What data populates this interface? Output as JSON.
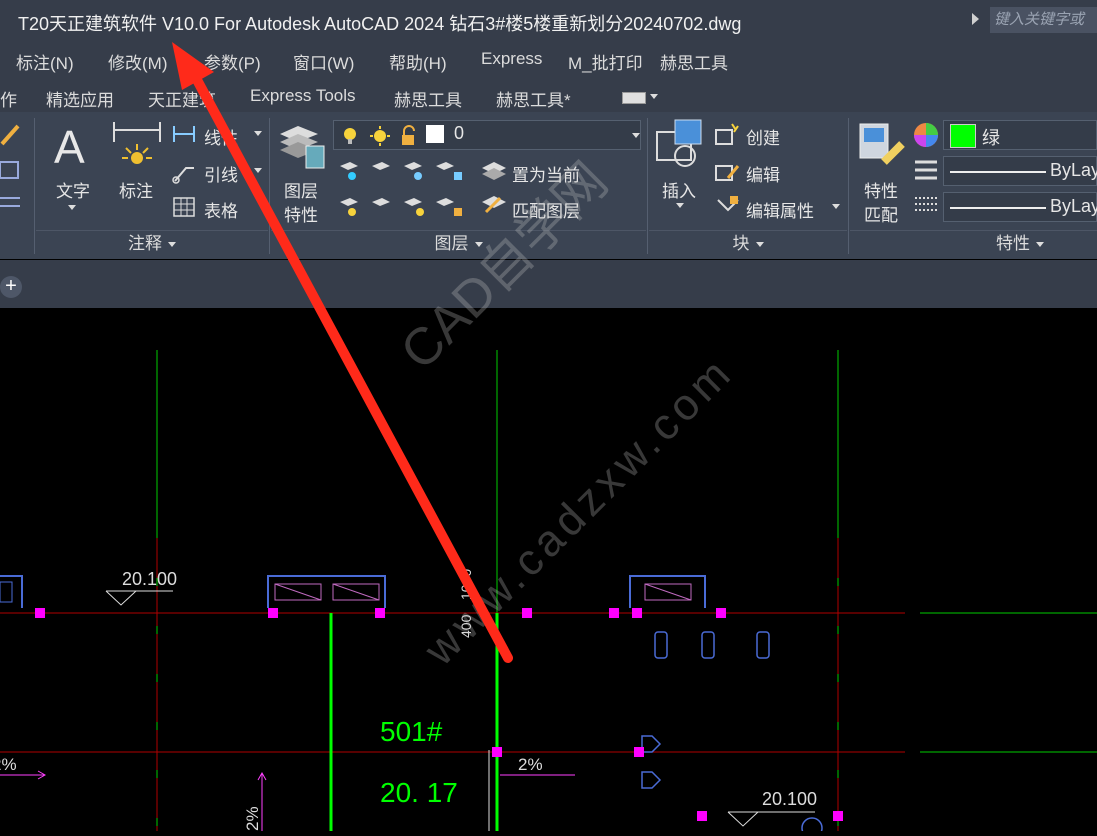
{
  "title": {
    "text": "T20天正建筑软件 V10.0 For Autodesk AutoCAD 2024    钻石3#楼5楼重新划分20240702.dwg",
    "search_placeholder": "键入关键字或"
  },
  "menubar": {
    "items": [
      "标注(N)",
      "修改(M)",
      "参数(P)",
      "窗口(W)",
      "帮助(H)",
      "Express",
      "M_批打印",
      "赫思工具"
    ]
  },
  "tabs": {
    "items": [
      "作",
      "精选应用",
      "天正建筑",
      "Express Tools",
      "赫思工具",
      "赫思工具*"
    ]
  },
  "ribbon": {
    "annotation": {
      "text_label": "文字",
      "dim_label": "标注",
      "linear_label": "线性",
      "leader_label": "引线",
      "table_label": "表格",
      "footer": "注释"
    },
    "layers": {
      "props_label_1": "图层",
      "props_label_2": "特性",
      "current_layer": "0",
      "make_current": "置为当前",
      "match_layer": "匹配图层",
      "footer": "图层"
    },
    "block": {
      "insert_label": "插入",
      "create": "创建",
      "edit": "编辑",
      "edit_attr": "编辑属性",
      "footer": "块"
    },
    "properties": {
      "match_1": "特性",
      "match_2": "匹配",
      "color_name": "绿",
      "linetype": "ByLay",
      "lineweight": "ByLay",
      "footer": "特性"
    }
  },
  "drawing": {
    "level_a": "20.100",
    "level_b": "20.100",
    "room_number": "501#",
    "area": "20. 17",
    "slope_a": "2%",
    "slope_b": "2%",
    "slope_c": "2%",
    "dim_vertical": "400",
    "dim_vertical_2": "1000",
    "watermark_1": "CAD自学网",
    "watermark_2": "www.cadzxw.com"
  },
  "colors": {
    "titlebar": "#363d4a",
    "ribbon": "#3b4453",
    "canvas": "#000000",
    "green": "#00ff00",
    "red_axis": "#c00000",
    "magenta": "#ff00ff",
    "blue": "#4a6bd6",
    "annotation_arrow": "#ff2a1a"
  }
}
